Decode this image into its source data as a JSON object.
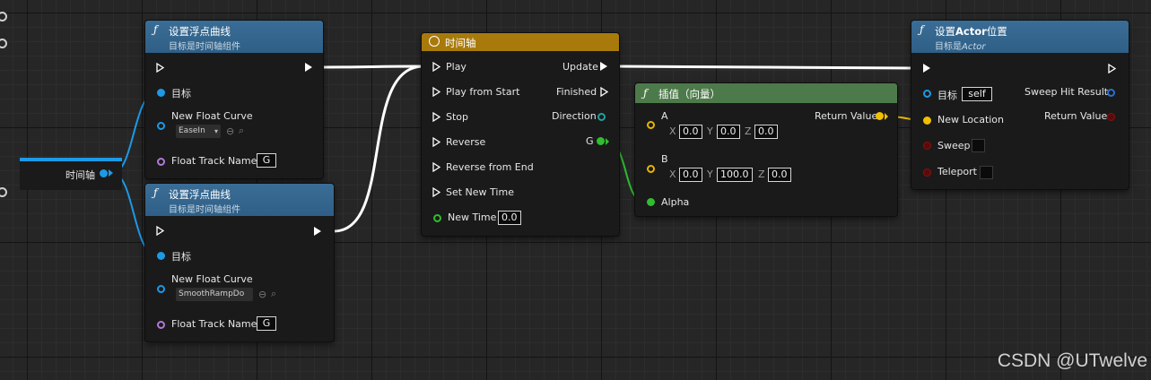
{
  "set_curve_1": {
    "title": "设置浮点曲线",
    "subtitle": "目标是时间轴组件",
    "target_label": "目标",
    "curve_label": "New Float Curve",
    "curve_value": "EaseIn",
    "track_label": "Float Track Name",
    "track_value": "G"
  },
  "set_curve_2": {
    "title": "设置浮点曲线",
    "subtitle": "目标是时间轴组件",
    "target_label": "目标",
    "curve_label": "New Float Curve",
    "curve_value": "SmoothRampDo",
    "track_label": "Float Track Name",
    "track_value": "G"
  },
  "timeline_var": {
    "label": "时间轴"
  },
  "timeline": {
    "title": "时间轴",
    "inputs": [
      "Play",
      "Play from Start",
      "Stop",
      "Reverse",
      "Reverse from End",
      "Set New Time"
    ],
    "new_time_label": "New Time",
    "new_time_value": "0.0",
    "outputs": {
      "update": "Update",
      "finished": "Finished",
      "direction": "Direction",
      "g": "G"
    }
  },
  "lerp": {
    "title": "插值（向量）",
    "a_label": "A",
    "a": {
      "x_label": "X",
      "x": "0.0",
      "y_label": "Y",
      "y": "0.0",
      "z_label": "Z",
      "z": "0.0"
    },
    "b_label": "B",
    "b": {
      "x_label": "X",
      "x": "0.0",
      "y_label": "Y",
      "y": "100.0",
      "z_label": "Z",
      "z": "0.0"
    },
    "alpha_label": "Alpha",
    "return_label": "Return Value"
  },
  "set_actor": {
    "title_prefix": "设置",
    "title_bold": "Actor",
    "title_suffix": "位置",
    "subtitle_prefix": "目标是",
    "subtitle_italic": "Actor",
    "target_label": "目标",
    "target_value": "self",
    "sweep_hit_label": "Sweep Hit Result",
    "new_location_label": "New Location",
    "return_label": "Return Value",
    "sweep_label": "Sweep",
    "teleport_label": "Teleport"
  },
  "watermark": "CSDN @UTwelve",
  "colors": {
    "exec": "#ffffff",
    "object_pin": "#1d99e6",
    "vector_pin": "#f0c000",
    "float_pin": "#2fbe2f",
    "name_pin": "#b07ad6",
    "function_header": "#2f5f86",
    "timeline_header": "#a87a0c",
    "pure_header": "#4d7a4a"
  }
}
